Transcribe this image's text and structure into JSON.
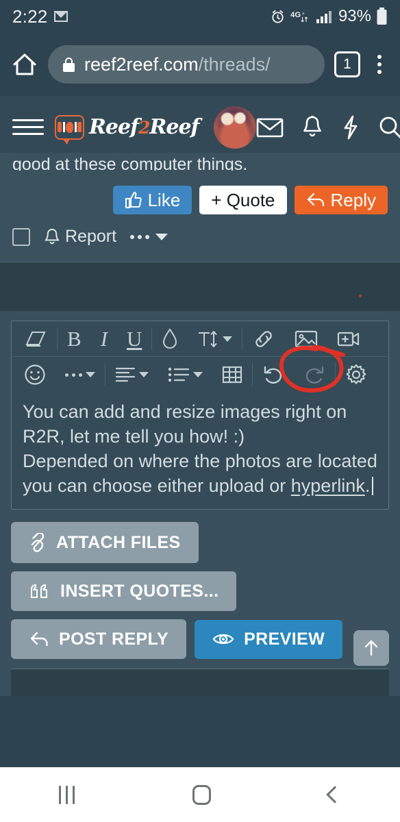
{
  "status_bar": {
    "time": "2:22",
    "notification_icon": "gmail-icon",
    "alarm_icon": "alarm-icon",
    "network": "4G+",
    "signal_icon": "signal-bars-icon",
    "battery_percent": "93%",
    "battery_icon": "battery-icon"
  },
  "browser": {
    "home_icon": "home-icon",
    "lock_icon": "lock-icon",
    "url_domain": "reef2reef.com",
    "url_path": "/threads/",
    "tab_count": "1",
    "menu_icon": "kebab-menu-icon"
  },
  "site_header": {
    "menu_icon": "hamburger-menu-icon",
    "logo_text": "Reef",
    "logo_text_2": "2",
    "logo_text_3": "Reef",
    "avatar": "user-avatar",
    "icons": [
      "inbox-envelope-icon",
      "alerts-bell-icon",
      "whats-new-bolt-icon",
      "search-icon"
    ]
  },
  "post": {
    "clipped_text": "good at these computer things.",
    "buttons": {
      "like": "Like",
      "quote": "+ Quote",
      "reply": "Reply"
    },
    "report": "Report",
    "more_icon": "more-options-icon",
    "select_checkbox": "post-select-checkbox"
  },
  "editor": {
    "toolbar_row1": [
      {
        "name": "remove-formatting-eraser-icon",
        "label": "",
        "dropdown": false,
        "highlighted": false
      },
      {
        "name": "bold-icon",
        "label": "B",
        "dropdown": false,
        "highlighted": false
      },
      {
        "name": "italic-icon",
        "label": "I",
        "dropdown": false,
        "highlighted": false
      },
      {
        "name": "underline-icon",
        "label": "U",
        "dropdown": false,
        "highlighted": false
      },
      {
        "name": "text-color-droplet-icon",
        "label": "",
        "dropdown": false,
        "highlighted": false
      },
      {
        "name": "font-size-icon",
        "label": "TI",
        "dropdown": true,
        "highlighted": false
      },
      {
        "name": "insert-link-icon",
        "label": "",
        "dropdown": false,
        "highlighted": false
      },
      {
        "name": "insert-image-icon",
        "label": "",
        "dropdown": false,
        "highlighted": true
      },
      {
        "name": "insert-video-icon",
        "label": "",
        "dropdown": false,
        "highlighted": false
      }
    ],
    "toolbar_row2": [
      {
        "name": "smilies-icon",
        "label": "",
        "dropdown": false,
        "disabled": false
      },
      {
        "name": "more-options-icon",
        "label": "",
        "dropdown": true,
        "disabled": false
      },
      {
        "name": "text-align-icon",
        "label": "",
        "dropdown": true,
        "disabled": false
      },
      {
        "name": "list-icon",
        "label": "",
        "dropdown": true,
        "disabled": false
      },
      {
        "name": "insert-table-icon",
        "label": "",
        "dropdown": false,
        "disabled": false
      },
      {
        "name": "undo-icon",
        "label": "",
        "dropdown": false,
        "disabled": false
      },
      {
        "name": "redo-icon",
        "label": "",
        "dropdown": false,
        "disabled": true
      },
      {
        "name": "editor-settings-gear-icon",
        "label": "",
        "dropdown": false,
        "disabled": false
      }
    ],
    "body_line1": "You can add and resize images right on R2R, let me tell you how! :)",
    "body_line2": "Depended on where the photos are located you can choose either upload or ",
    "body_link": "hyperlink",
    "body_end": "."
  },
  "actions": {
    "attach_files": "ATTACH FILES",
    "attach_icon": "paperclip-icon",
    "insert_quotes": "INSERT QUOTES...",
    "quotes_icon": "quote-marks-icon",
    "post_reply": "POST REPLY",
    "post_reply_icon": "reply-arrow-icon",
    "preview": "PREVIEW",
    "preview_icon": "eye-icon",
    "scroll_top_icon": "scroll-to-top-arrow-icon"
  },
  "annotation": {
    "shape": "red-hand-drawn-circle",
    "target": "insert-image-icon",
    "color": "#e03127"
  },
  "nav_bar": {
    "recents_icon": "recents-icon",
    "home_icon": "home-icon",
    "back_icon": "back-icon"
  },
  "colors": {
    "page_bg": "#2e4350",
    "header_bg": "#334a56",
    "post_bg": "#3b515d",
    "editor_bg": "#354b57",
    "like_blue": "#3f86c4",
    "reply_orange": "#ec6527",
    "preview_blue": "#2b87bd",
    "button_grey": "#8d9ea8",
    "annotation_red": "#e03127"
  }
}
